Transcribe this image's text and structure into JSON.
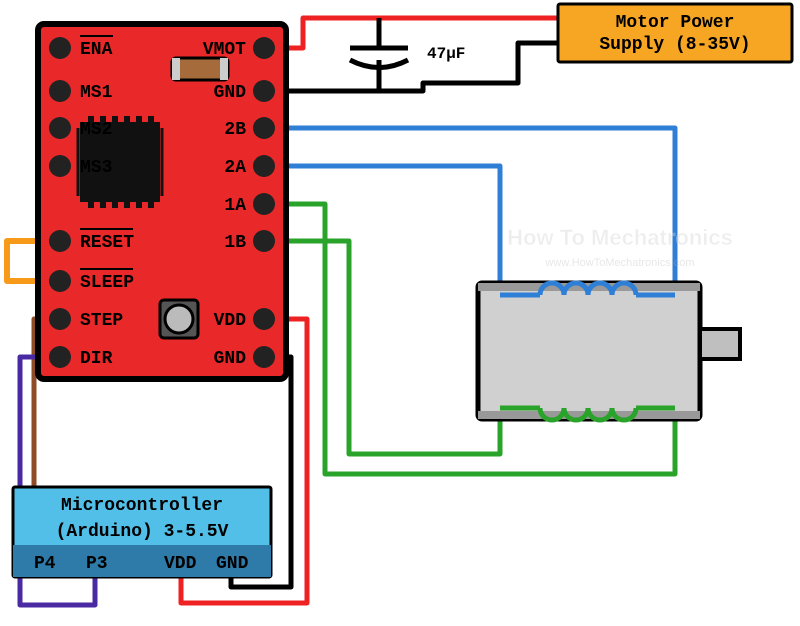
{
  "driver": {
    "left_pins": [
      "ENA",
      "MS1",
      "MS2",
      "MS3",
      "RESET",
      "SLEEP",
      "STEP",
      "DIR"
    ],
    "right_pins": [
      "VMOT",
      "GND",
      "2B",
      "2A",
      "1A",
      "1B",
      "VDD",
      "GND"
    ],
    "ena_overline": true
  },
  "capacitor": {
    "label": "47µF"
  },
  "power_supply": {
    "line1": "Motor Power",
    "line2": "Supply (8-35V)"
  },
  "mcu": {
    "title": "Microcontroller",
    "subtitle": "(Arduino) 3-5.5V",
    "pins": [
      "P4",
      "P3",
      "VDD",
      "GND"
    ]
  },
  "watermark": {
    "logo_text": "How To Mechatronics",
    "url": "www.HowToMechatronics.com"
  },
  "colors": {
    "board": "#e92929",
    "board_dark": "#222222",
    "accent_blue": "#2f7fd6",
    "accent_green": "#29a329",
    "accent_orange": "#f79a1a",
    "accent_purple": "#4a2aa3",
    "accent_brown": "#8e4d27",
    "psu_fill": "#f6a623",
    "mcu_fill": "#52bfe8"
  }
}
